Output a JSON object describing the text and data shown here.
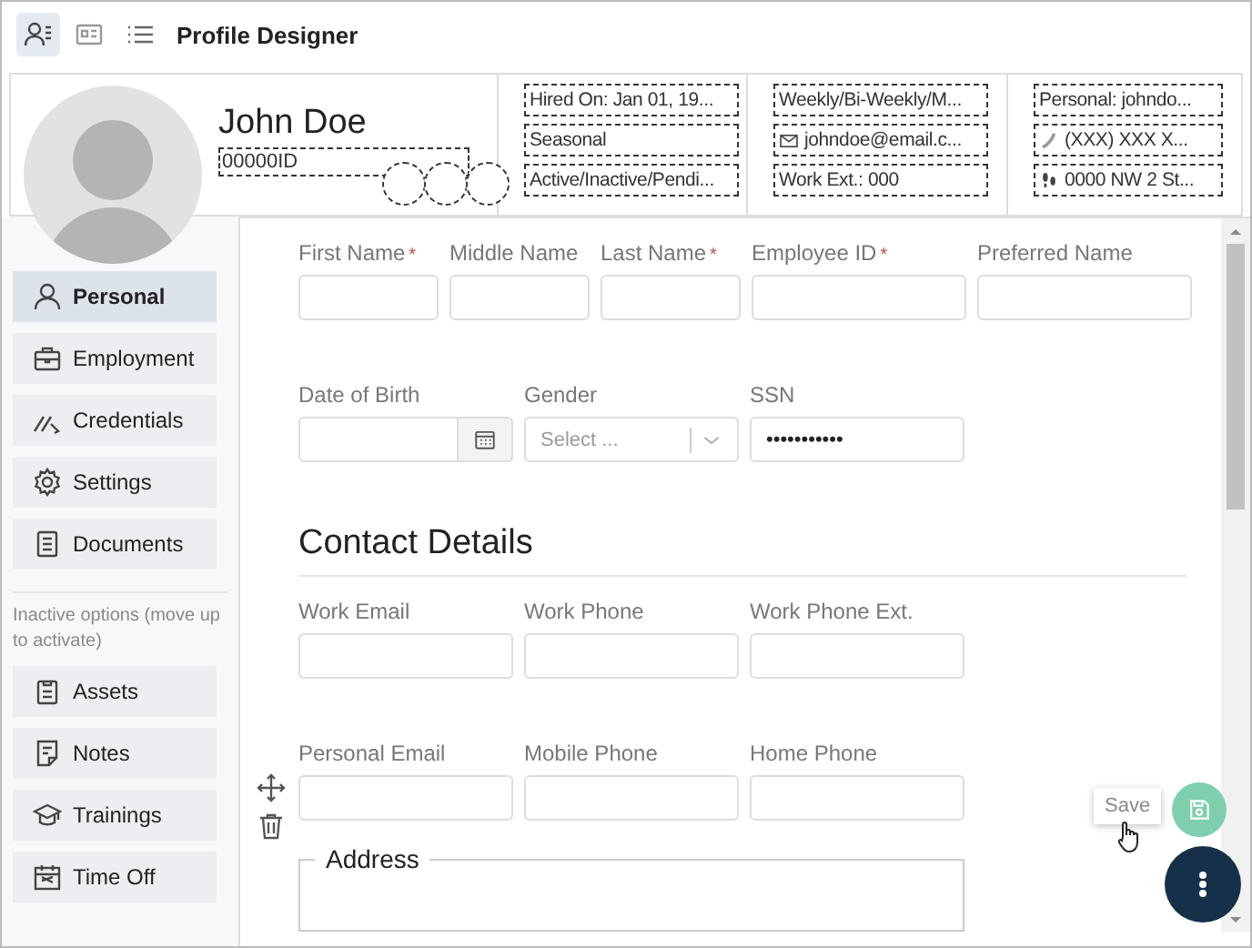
{
  "toolbar": {
    "views": [
      {
        "selected": true
      },
      {
        "selected": false
      },
      {
        "selected": false
      }
    ],
    "title": "Profile Designer"
  },
  "profile": {
    "name": "John Doe",
    "id": "00000ID",
    "info_columns": [
      [
        {
          "kind": "text",
          "text": "Hired On: Jan 01, 19..."
        },
        {
          "kind": "text",
          "text": "Seasonal"
        },
        {
          "kind": "text",
          "text": "Active/Inactive/Pendi..."
        }
      ],
      [
        {
          "kind": "text",
          "text": "Weekly/Bi-Weekly/M..."
        },
        {
          "kind": "email",
          "text": "johndoe@email.c..."
        },
        {
          "kind": "text",
          "text": "Work Ext.: 000"
        }
      ],
      [
        {
          "kind": "text",
          "text": "Personal: johndo..."
        },
        {
          "kind": "phone",
          "text": "(XXX) XXX X..."
        },
        {
          "kind": "address",
          "text": "0000 NW 2 St..."
        }
      ]
    ]
  },
  "sidebar": {
    "active_items": [
      {
        "label": "Personal",
        "selected": true
      },
      {
        "label": "Employment",
        "selected": false
      },
      {
        "label": "Credentials",
        "selected": false
      },
      {
        "label": "Settings",
        "selected": false
      },
      {
        "label": "Documents",
        "selected": false
      }
    ],
    "inactive_note": "Inactive options (move up to activate)",
    "inactive_items": [
      {
        "label": "Assets",
        "selected": false
      },
      {
        "label": "Notes",
        "selected": false
      },
      {
        "label": "Trainings",
        "selected": false
      },
      {
        "label": "Time Off",
        "selected": false
      }
    ]
  },
  "form": {
    "sections": [
      {
        "kind": "fields",
        "rows": [
          {
            "fields": [
              {
                "kind": "text",
                "label": "First Name",
                "required_mark": "*"
              },
              {
                "kind": "text",
                "label": "Middle Name"
              },
              {
                "kind": "text",
                "label": "Last Name",
                "required_mark": "*"
              },
              {
                "kind": "text",
                "label": "Employee ID",
                "required_mark": "*"
              },
              {
                "kind": "text",
                "label": "Preferred Name"
              }
            ]
          },
          {
            "fields": [
              {
                "kind": "date",
                "label": "Date of Birth"
              },
              {
                "kind": "select",
                "label": "Gender",
                "placeholder": "Select ..."
              },
              {
                "kind": "password",
                "label": "SSN",
                "value": "•••••••••••"
              }
            ]
          }
        ]
      },
      {
        "kind": "heading",
        "title": "Contact Details"
      },
      {
        "kind": "fields",
        "rows": [
          {
            "fields": [
              {
                "kind": "text",
                "label": "Work Email"
              },
              {
                "kind": "text",
                "label": "Work Phone"
              },
              {
                "kind": "text",
                "label": "Work Phone Ext."
              }
            ]
          },
          {
            "movable": true,
            "fields": [
              {
                "kind": "text",
                "label": "Personal Email"
              },
              {
                "kind": "text",
                "label": "Mobile Phone"
              },
              {
                "kind": "text",
                "label": "Home Phone"
              }
            ]
          }
        ]
      },
      {
        "kind": "group",
        "legend": "Address"
      }
    ],
    "save_tooltip": "Save"
  }
}
